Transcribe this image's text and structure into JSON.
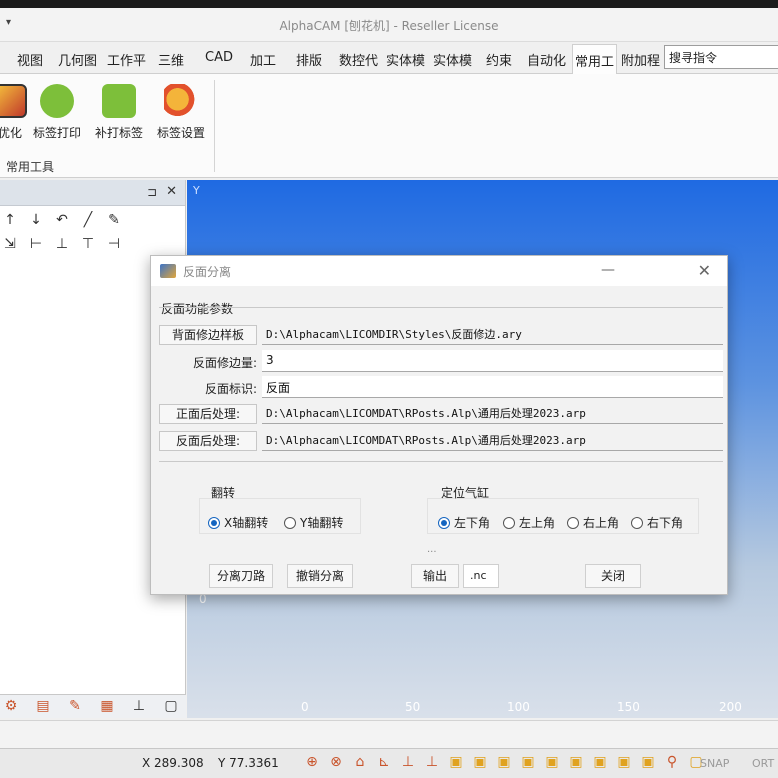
{
  "app": {
    "title": "AlphaCAM [刨花机] - Reseller License",
    "qa_glyph": "▾"
  },
  "tabs": [
    {
      "label": "视图"
    },
    {
      "label": "几何图"
    },
    {
      "label": "工作平"
    },
    {
      "label": "三维"
    },
    {
      "label": "CAD"
    },
    {
      "label": "加工"
    },
    {
      "label": "排版"
    },
    {
      "label": "数控代"
    },
    {
      "label": "实体模"
    },
    {
      "label": "实体模"
    },
    {
      "label": "约束"
    },
    {
      "label": "自动化"
    },
    {
      "label": "常用工"
    },
    {
      "label": "附加程"
    }
  ],
  "search": {
    "value": "搜寻指令"
  },
  "ribbon": {
    "buttons": [
      {
        "label": "优化",
        "icon": "optimize-icon"
      },
      {
        "label": "标签打印",
        "icon": "label-print-icon"
      },
      {
        "label": "补打标签",
        "icon": "reprint-label-icon"
      },
      {
        "label": "标签设置",
        "icon": "label-settings-icon"
      }
    ],
    "group_label": "常用工具"
  },
  "panel": {
    "pin": "⊐",
    "close": "✕",
    "row1": [
      "↑",
      "↓",
      "↶",
      "╱",
      "✎"
    ],
    "row2": [
      "⇲",
      "⊢",
      "⊥",
      "⊤",
      "⊣"
    ],
    "bottom": [
      "⚙",
      "▤",
      "✎",
      "▦",
      "⊥",
      "▢"
    ]
  },
  "canvas": {
    "y_axis_label": "Y",
    "x_ticks": [
      "0",
      "50",
      "100",
      "150",
      "200"
    ],
    "y_zero": "0",
    "colors": {
      "top": "#1f6ae2",
      "bottom": "#d9e0ea"
    }
  },
  "status": {
    "x": "X 289.308",
    "y": "Y 77.3361",
    "snap": "SNAP",
    "ortho": "ORT",
    "icons": [
      "⊕",
      "⊗",
      "⌂",
      "⊾",
      "⊥",
      "⊥",
      "▣",
      "▣",
      "▣",
      "▣",
      "▣",
      "▣",
      "▣",
      "▣",
      "▣",
      "⚲",
      "▢"
    ]
  },
  "dialog": {
    "title": "反面分离",
    "minimize": "—",
    "close": "✕",
    "section": "反面功能参数",
    "fields": [
      {
        "label": "背面修边样板",
        "is_button": true,
        "value": "D:\\Alphacam\\LICOMDIR\\Styles\\反面修边.ary"
      },
      {
        "label": "反面修边量:",
        "is_button": false,
        "value": "3"
      },
      {
        "label": "反面标识:",
        "is_button": false,
        "value": "反面"
      },
      {
        "label": "正面后处理:",
        "is_button": true,
        "value": "D:\\Alphacam\\LICOMDAT\\RPosts.Alp\\通用后处理2023.arp"
      },
      {
        "label": "反面后处理:",
        "is_button": true,
        "value": "D:\\Alphacam\\LICOMDAT\\RPosts.Alp\\通用后处理2023.arp"
      }
    ],
    "flip": {
      "title": "翻转",
      "options": [
        {
          "label": "X轴翻转",
          "selected": true
        },
        {
          "label": "Y轴翻转",
          "selected": false
        }
      ]
    },
    "cylinder": {
      "title": "定位气缸",
      "options": [
        {
          "label": "左下角",
          "selected": true
        },
        {
          "label": "左上角",
          "selected": false
        },
        {
          "label": "右上角",
          "selected": false
        },
        {
          "label": "右下角",
          "selected": false
        }
      ]
    },
    "dots": "...",
    "buttons": {
      "split_path": "分离刀路",
      "undo_split": "撤销分离",
      "output": "输出",
      "ext": ".nc",
      "close": "关闭"
    }
  }
}
